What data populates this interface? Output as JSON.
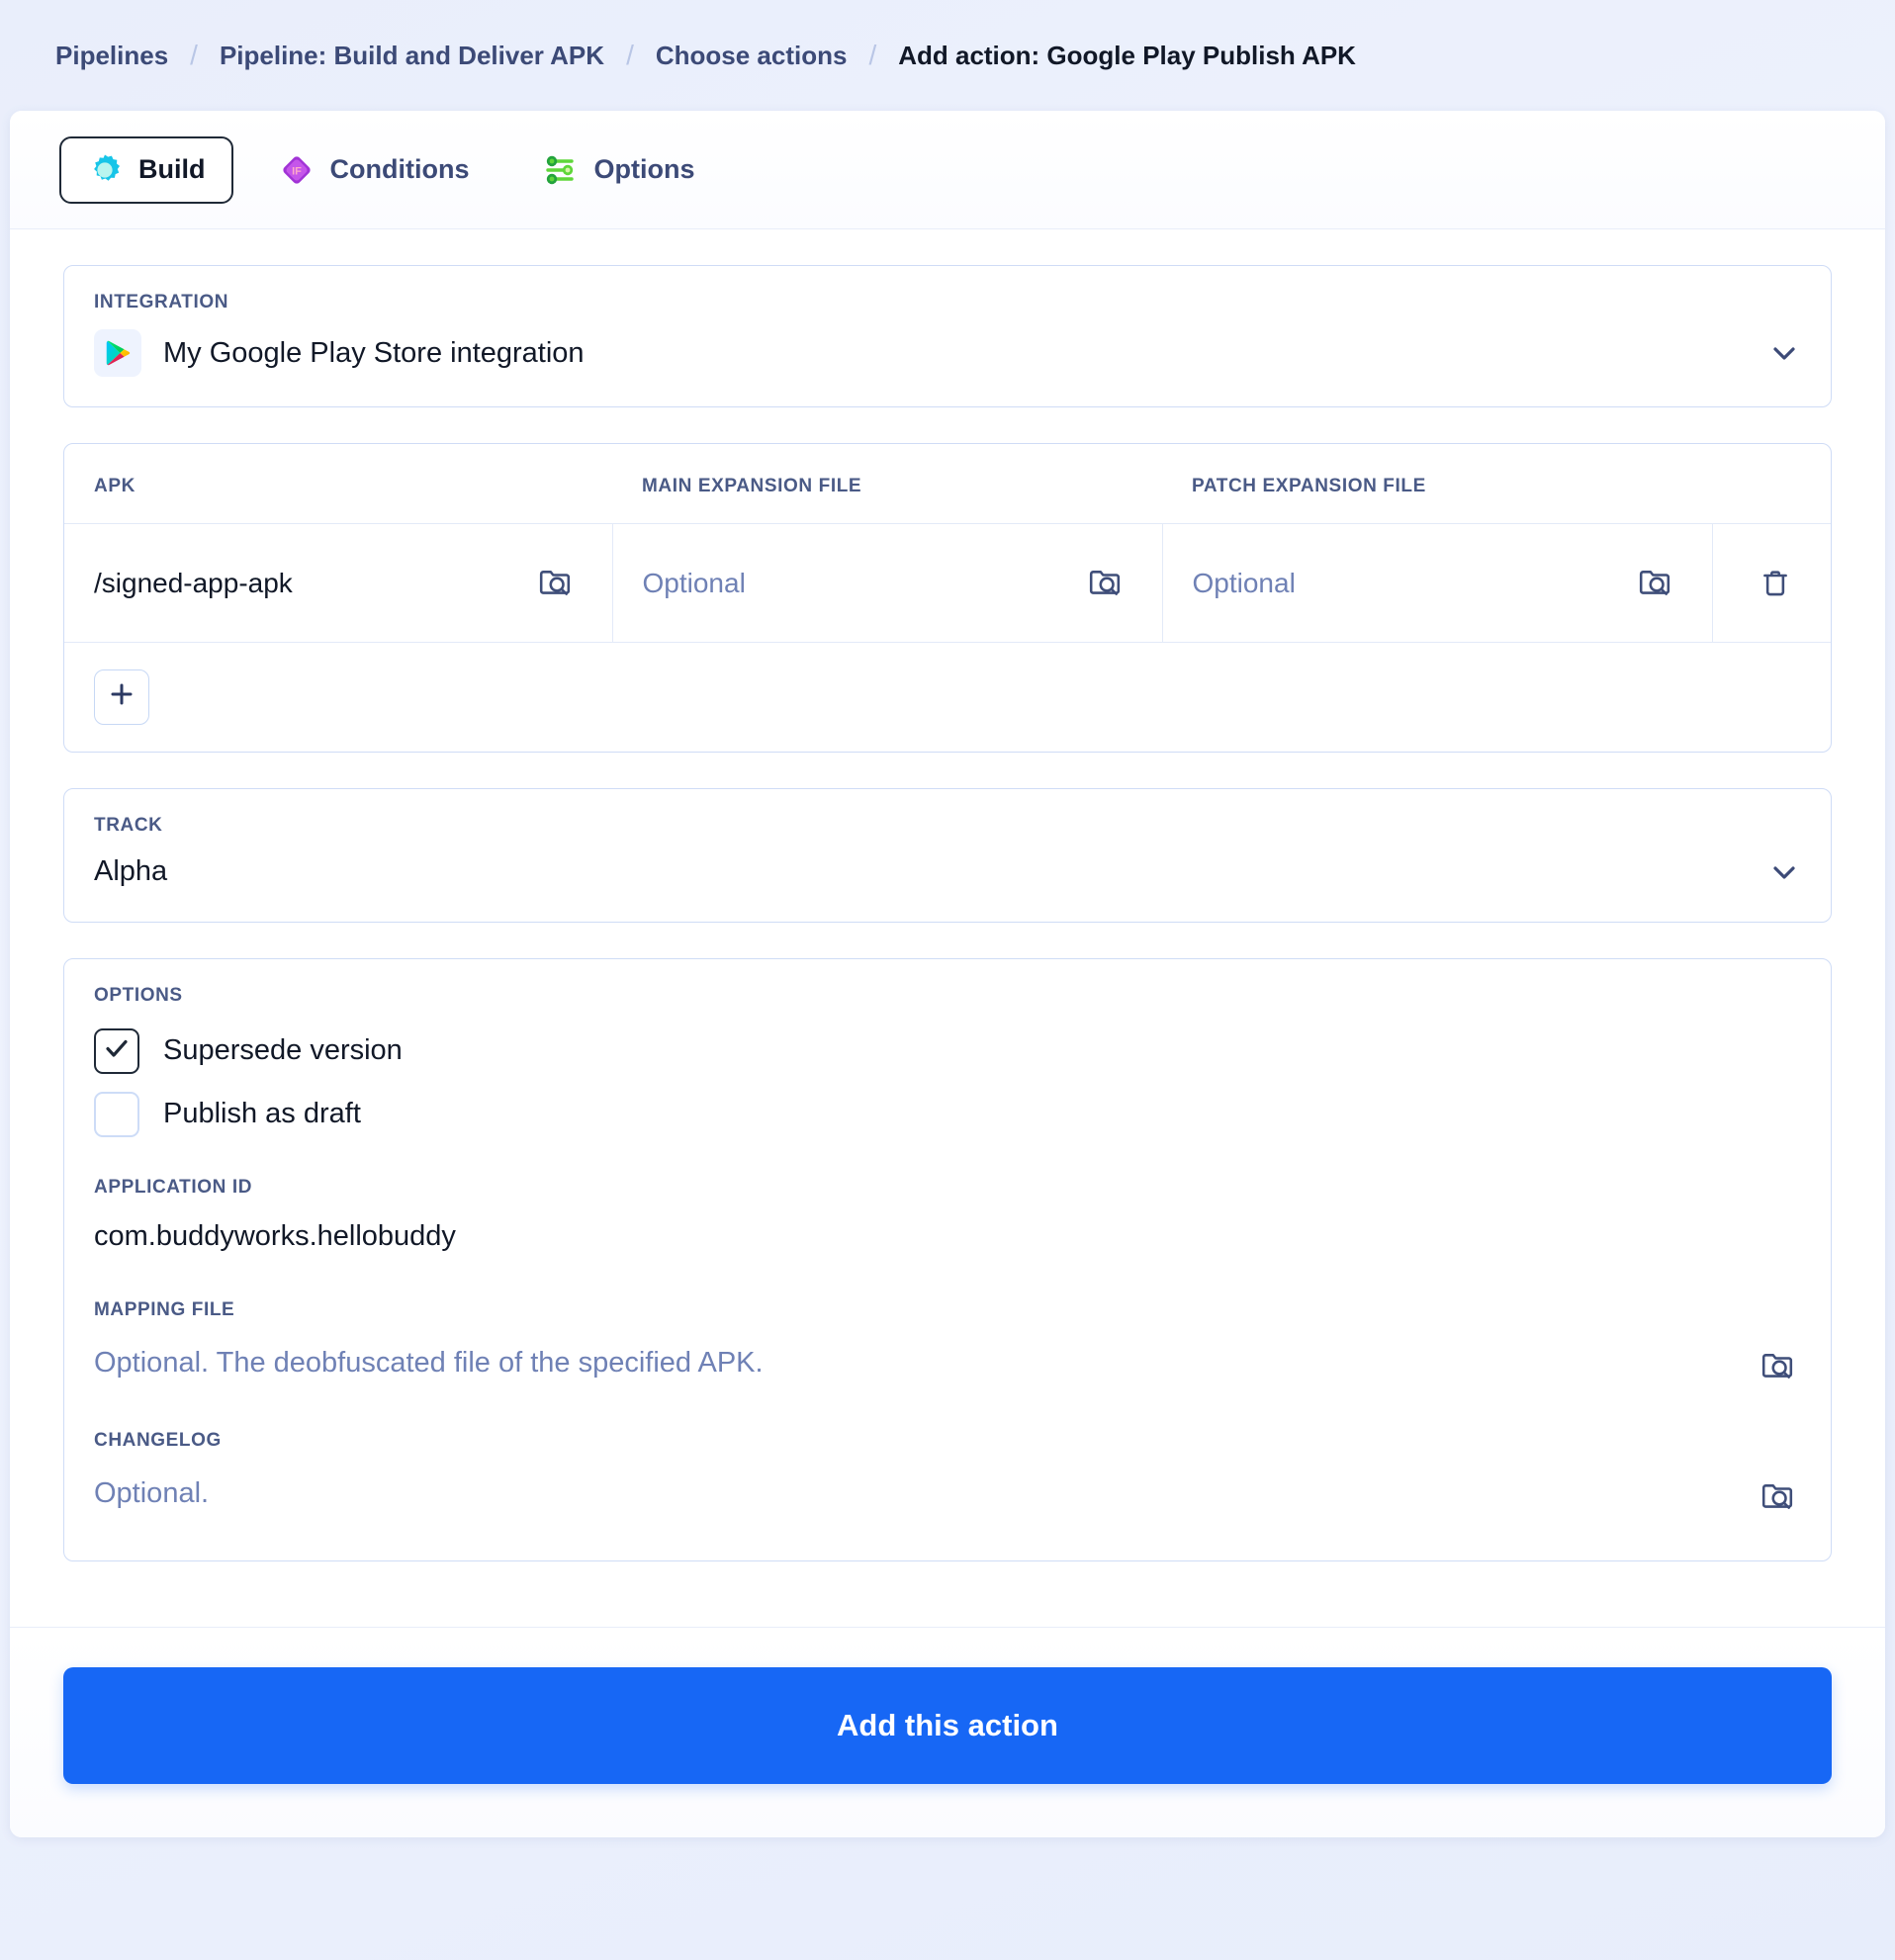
{
  "breadcrumb": {
    "items": [
      {
        "label": "Pipelines",
        "current": false
      },
      {
        "label": "Pipeline: Build and Deliver APK",
        "current": false
      },
      {
        "label": "Choose actions",
        "current": false
      },
      {
        "label": "Add action: Google Play Publish APK",
        "current": true
      }
    ],
    "separator": "/"
  },
  "tabs": [
    {
      "label": "Build",
      "icon": "build-gear-icon",
      "active": true
    },
    {
      "label": "Conditions",
      "icon": "conditions-if-diamond-icon",
      "active": false
    },
    {
      "label": "Options",
      "icon": "options-sliders-icon",
      "active": false
    }
  ],
  "integration": {
    "label": "INTEGRATION",
    "value": "My Google Play Store integration",
    "icon": "google-play-icon",
    "chevron": "chevron-down-icon"
  },
  "files_table": {
    "headers": [
      "APK",
      "MAIN EXPANSION FILE",
      "PATCH EXPANSION FILE",
      ""
    ],
    "rows": [
      {
        "apk": "/signed-app-apk",
        "apk_is_placeholder": false,
        "main_expansion": "Optional",
        "main_is_placeholder": true,
        "patch_expansion": "Optional",
        "patch_is_placeholder": true
      }
    ],
    "browse_icon": "folder-search-icon",
    "delete_icon": "trash-icon",
    "add_icon": "plus-icon"
  },
  "track": {
    "label": "TRACK",
    "value": "Alpha",
    "chevron": "chevron-down-icon"
  },
  "options": {
    "label": "OPTIONS",
    "checkboxes": [
      {
        "label": "Supersede version",
        "checked": true
      },
      {
        "label": "Publish as draft",
        "checked": false
      }
    ],
    "application_id": {
      "label": "APPLICATION ID",
      "value": "com.buddyworks.hellobuddy",
      "is_placeholder": false
    },
    "mapping_file": {
      "label": "MAPPING FILE",
      "value": "Optional. The deobfuscated file of the specified APK.",
      "is_placeholder": true,
      "icon": "folder-search-icon"
    },
    "changelog": {
      "label": "CHANGELOG",
      "value": "Optional.",
      "is_placeholder": true,
      "icon": "folder-search-icon"
    }
  },
  "footer": {
    "submit_label": "Add this action"
  },
  "colors": {
    "primary": "#1767f5",
    "label_text": "#4a5a86",
    "placeholder_text": "#6f81b5",
    "border": "#cfdcf6",
    "page_background": "#eef2fc"
  }
}
